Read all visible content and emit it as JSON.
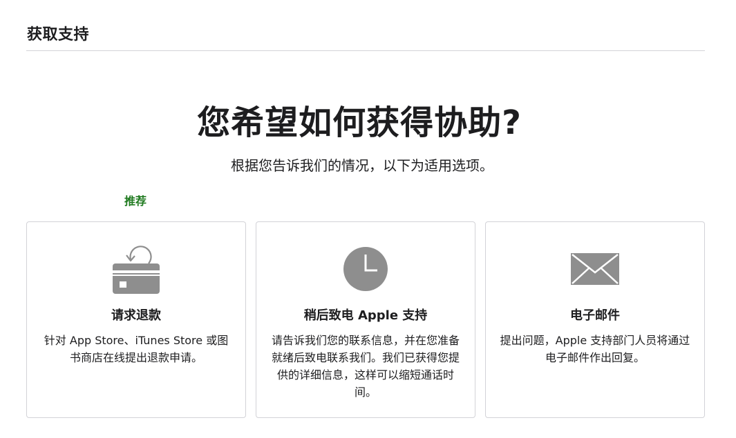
{
  "header": {
    "title": "获取支持"
  },
  "hero": {
    "title": "您希望如何获得协助?",
    "subtitle": "根据您告诉我们的情况，以下为适用选项。"
  },
  "recommended_label": "推荐",
  "cards": [
    {
      "icon": "credit-card-refund-icon",
      "title": "请求退款",
      "description": "针对 App Store、iTunes Store 或图书商店在线提出退款申请。"
    },
    {
      "icon": "clock-icon",
      "title": "稍后致电 Apple 支持",
      "description": "请告诉我们您的联系信息，并在您准备就绪后致电联系我们。我们已获得您提供的详细信息，这样可以缩短通话时间。"
    },
    {
      "icon": "envelope-icon",
      "title": "电子邮件",
      "description": "提出问题，Apple 支持部门人员将通过电子邮件作出回复。"
    }
  ],
  "colors": {
    "recommended": "#1f7a1f",
    "icon": "#8e8e8e",
    "border": "#d2d2d7",
    "text": "#1d1d1f"
  }
}
